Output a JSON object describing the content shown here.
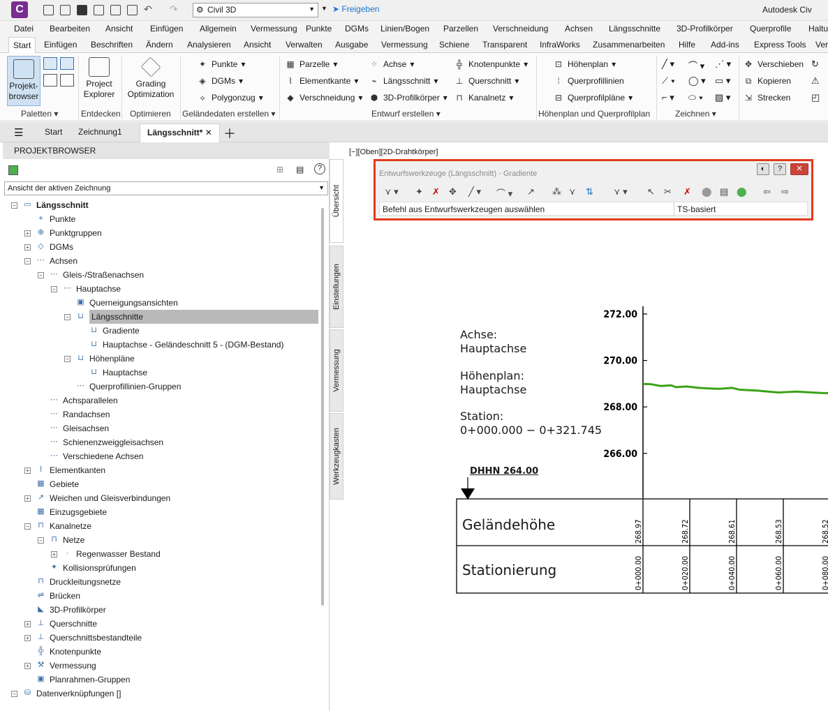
{
  "titlebar": {
    "logo": "C",
    "workspace": "Civil 3D",
    "share": "Freigeben",
    "app_title": "Autodesk Civ"
  },
  "menubar": [
    "Datei",
    "Bearbeiten",
    "Ansicht",
    "Einfügen",
    "Allgemein",
    "Vermessung",
    "Punkte",
    "DGMs",
    "Linien/Bogen",
    "Parzellen",
    "Verschneidung",
    "Achsen",
    "Längsschnitte",
    "3D-Profilkörper",
    "Querprofile",
    "Haltu"
  ],
  "ribbon_tabs": [
    "Start",
    "Einfügen",
    "Beschriften",
    "Ändern",
    "Analysieren",
    "Ansicht",
    "Verwalten",
    "Ausgabe",
    "Vermessung",
    "Schiene",
    "Transparent",
    "InfraWorks",
    "Zusammenarbeiten",
    "Hilfe",
    "Add-ins",
    "Express Tools",
    "Ver"
  ],
  "ribbon": {
    "projektbrowser": "Projekt-\nbrowser",
    "project_explorer": "Project\nExplorer",
    "grading": "Grading\nOptimization",
    "groups": [
      "Paletten",
      "Entdecken",
      "Optimieren",
      "Geländedaten erstellen",
      "Entwurf erstellen",
      "Höhenplan und Querprofilplan",
      "Zeichnen"
    ],
    "col1": [
      "Punkte",
      "DGMs",
      "Polygonzug"
    ],
    "col2": [
      "Parzelle",
      "Elementkante",
      "Verschneidung"
    ],
    "col3": [
      "Achse",
      "Längsschnitt",
      "3D-Profilkörper"
    ],
    "col4": [
      "Knotenpunkte",
      "Querschnitt",
      "Kanalnetz"
    ],
    "col5": [
      "Höhenplan",
      "Querprofillinien",
      "Querprofilpläne"
    ],
    "col6": [
      "Verschieben",
      "Kopieren",
      "Strecken"
    ]
  },
  "doctabs": [
    "Start",
    "Zeichnung1",
    "Längsschnitt*"
  ],
  "palette": {
    "header": "PROJEKTBROWSER",
    "view_select": "Ansicht der aktiven Zeichnung",
    "vtabs": [
      "Übersicht",
      "Einstellungen",
      "Vermessung",
      "Werkzeugkasten"
    ],
    "tree": [
      "Längsschnitt",
      "Punkte",
      "Punktgruppen",
      "DGMs",
      "Achsen",
      "Gleis-/Straßenachsen",
      "Hauptachse",
      "Querneigungsansichten",
      "Längsschnitte",
      "Gradiente",
      "Hauptachse - Geländeschnitt 5 - (DGM-Bestand)",
      "Höhenpläne",
      "Hauptachse",
      "Querprofillinien-Gruppen",
      "Achsparallelen",
      "Randachsen",
      "Gleisachsen",
      "Schienenzweiggleisachsen",
      "Verschiedene Achsen",
      "Elementkanten",
      "Gebiete",
      "Weichen und Gleisverbindungen",
      "Einzugsgebiete",
      "Kanalnetze",
      "Netze",
      "Regenwasser Bestand",
      "Kollisionsprüfungen",
      "Druckleitungsnetze",
      "Brücken",
      "3D-Profilkörper",
      "Querschnitte",
      "Querschnittsbestandteile",
      "Knotenpunkte",
      "Vermessung",
      "Planrahmen-Gruppen",
      "Datenverknüpfungen []"
    ]
  },
  "canvas": {
    "viewport_label": "[−][Oben][2D-Drahtkörper]",
    "toolbar": {
      "title": "Entwurfswerkzeuge (Längsschnitt) - Gradiente",
      "status": "Befehl aus Entwurfswerkzeugen auswählen",
      "status_right": "TS-basiert"
    },
    "info": {
      "achse_label": "Achse:",
      "achse": "Hauptachse",
      "hp_label": "Höhenplan:",
      "hp": "Hauptachse",
      "station_label": "Station:",
      "station": "0+000.000  −  0+321.745"
    },
    "datum": "DHHN 264.00",
    "band_labels": [
      "Geländehöhe",
      "Stationierung"
    ]
  },
  "chart_data": {
    "type": "line",
    "title": "",
    "xlabel": "",
    "ylabel": "",
    "y_ticks": [
      "272.00",
      "270.00",
      "268.00",
      "266.00"
    ],
    "ylim": [
      264,
      273
    ],
    "series": [
      {
        "values": [
          268.99,
          268.98,
          268.9,
          268.93,
          268.85,
          268.88,
          268.82,
          268.8,
          268.78,
          268.82,
          268.74,
          268.7,
          268.62,
          268.66,
          268.6,
          268.58,
          268.62,
          268.56,
          268.52,
          268.4,
          268.52,
          268.5,
          268.55,
          268.48,
          268.5,
          268.52,
          268.5
        ],
        "color": "#3aa316"
      }
    ],
    "x": [
      0,
      3,
      7,
      11,
      13,
      17,
      22,
      25,
      30,
      35,
      38,
      45,
      53,
      60,
      70,
      78,
      85,
      90,
      96,
      100,
      106,
      118,
      128,
      140,
      150,
      165,
      180
    ],
    "band_elevations": [
      "268.97",
      "268.72",
      "268.61",
      "268.53",
      "268.52"
    ],
    "band_stations": [
      "0+000.00",
      "0+020.00",
      "0+040.00",
      "0+060.00",
      "0+080.00"
    ]
  }
}
